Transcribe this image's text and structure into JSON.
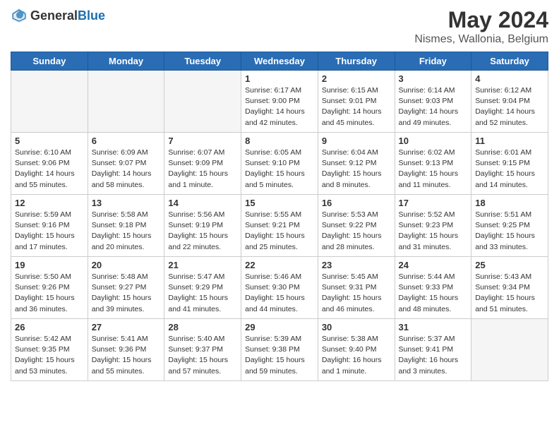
{
  "header": {
    "logo_general": "General",
    "logo_blue": "Blue",
    "title": "May 2024",
    "subtitle": "Nismes, Wallonia, Belgium"
  },
  "weekdays": [
    "Sunday",
    "Monday",
    "Tuesday",
    "Wednesday",
    "Thursday",
    "Friday",
    "Saturday"
  ],
  "weeks": [
    [
      {
        "day": "",
        "info": ""
      },
      {
        "day": "",
        "info": ""
      },
      {
        "day": "",
        "info": ""
      },
      {
        "day": "1",
        "info": "Sunrise: 6:17 AM\nSunset: 9:00 PM\nDaylight: 14 hours\nand 42 minutes."
      },
      {
        "day": "2",
        "info": "Sunrise: 6:15 AM\nSunset: 9:01 PM\nDaylight: 14 hours\nand 45 minutes."
      },
      {
        "day": "3",
        "info": "Sunrise: 6:14 AM\nSunset: 9:03 PM\nDaylight: 14 hours\nand 49 minutes."
      },
      {
        "day": "4",
        "info": "Sunrise: 6:12 AM\nSunset: 9:04 PM\nDaylight: 14 hours\nand 52 minutes."
      }
    ],
    [
      {
        "day": "5",
        "info": "Sunrise: 6:10 AM\nSunset: 9:06 PM\nDaylight: 14 hours\nand 55 minutes."
      },
      {
        "day": "6",
        "info": "Sunrise: 6:09 AM\nSunset: 9:07 PM\nDaylight: 14 hours\nand 58 minutes."
      },
      {
        "day": "7",
        "info": "Sunrise: 6:07 AM\nSunset: 9:09 PM\nDaylight: 15 hours\nand 1 minute."
      },
      {
        "day": "8",
        "info": "Sunrise: 6:05 AM\nSunset: 9:10 PM\nDaylight: 15 hours\nand 5 minutes."
      },
      {
        "day": "9",
        "info": "Sunrise: 6:04 AM\nSunset: 9:12 PM\nDaylight: 15 hours\nand 8 minutes."
      },
      {
        "day": "10",
        "info": "Sunrise: 6:02 AM\nSunset: 9:13 PM\nDaylight: 15 hours\nand 11 minutes."
      },
      {
        "day": "11",
        "info": "Sunrise: 6:01 AM\nSunset: 9:15 PM\nDaylight: 15 hours\nand 14 minutes."
      }
    ],
    [
      {
        "day": "12",
        "info": "Sunrise: 5:59 AM\nSunset: 9:16 PM\nDaylight: 15 hours\nand 17 minutes."
      },
      {
        "day": "13",
        "info": "Sunrise: 5:58 AM\nSunset: 9:18 PM\nDaylight: 15 hours\nand 20 minutes."
      },
      {
        "day": "14",
        "info": "Sunrise: 5:56 AM\nSunset: 9:19 PM\nDaylight: 15 hours\nand 22 minutes."
      },
      {
        "day": "15",
        "info": "Sunrise: 5:55 AM\nSunset: 9:21 PM\nDaylight: 15 hours\nand 25 minutes."
      },
      {
        "day": "16",
        "info": "Sunrise: 5:53 AM\nSunset: 9:22 PM\nDaylight: 15 hours\nand 28 minutes."
      },
      {
        "day": "17",
        "info": "Sunrise: 5:52 AM\nSunset: 9:23 PM\nDaylight: 15 hours\nand 31 minutes."
      },
      {
        "day": "18",
        "info": "Sunrise: 5:51 AM\nSunset: 9:25 PM\nDaylight: 15 hours\nand 33 minutes."
      }
    ],
    [
      {
        "day": "19",
        "info": "Sunrise: 5:50 AM\nSunset: 9:26 PM\nDaylight: 15 hours\nand 36 minutes."
      },
      {
        "day": "20",
        "info": "Sunrise: 5:48 AM\nSunset: 9:27 PM\nDaylight: 15 hours\nand 39 minutes."
      },
      {
        "day": "21",
        "info": "Sunrise: 5:47 AM\nSunset: 9:29 PM\nDaylight: 15 hours\nand 41 minutes."
      },
      {
        "day": "22",
        "info": "Sunrise: 5:46 AM\nSunset: 9:30 PM\nDaylight: 15 hours\nand 44 minutes."
      },
      {
        "day": "23",
        "info": "Sunrise: 5:45 AM\nSunset: 9:31 PM\nDaylight: 15 hours\nand 46 minutes."
      },
      {
        "day": "24",
        "info": "Sunrise: 5:44 AM\nSunset: 9:33 PM\nDaylight: 15 hours\nand 48 minutes."
      },
      {
        "day": "25",
        "info": "Sunrise: 5:43 AM\nSunset: 9:34 PM\nDaylight: 15 hours\nand 51 minutes."
      }
    ],
    [
      {
        "day": "26",
        "info": "Sunrise: 5:42 AM\nSunset: 9:35 PM\nDaylight: 15 hours\nand 53 minutes."
      },
      {
        "day": "27",
        "info": "Sunrise: 5:41 AM\nSunset: 9:36 PM\nDaylight: 15 hours\nand 55 minutes."
      },
      {
        "day": "28",
        "info": "Sunrise: 5:40 AM\nSunset: 9:37 PM\nDaylight: 15 hours\nand 57 minutes."
      },
      {
        "day": "29",
        "info": "Sunrise: 5:39 AM\nSunset: 9:38 PM\nDaylight: 15 hours\nand 59 minutes."
      },
      {
        "day": "30",
        "info": "Sunrise: 5:38 AM\nSunset: 9:40 PM\nDaylight: 16 hours\nand 1 minute."
      },
      {
        "day": "31",
        "info": "Sunrise: 5:37 AM\nSunset: 9:41 PM\nDaylight: 16 hours\nand 3 minutes."
      },
      {
        "day": "",
        "info": ""
      }
    ]
  ]
}
